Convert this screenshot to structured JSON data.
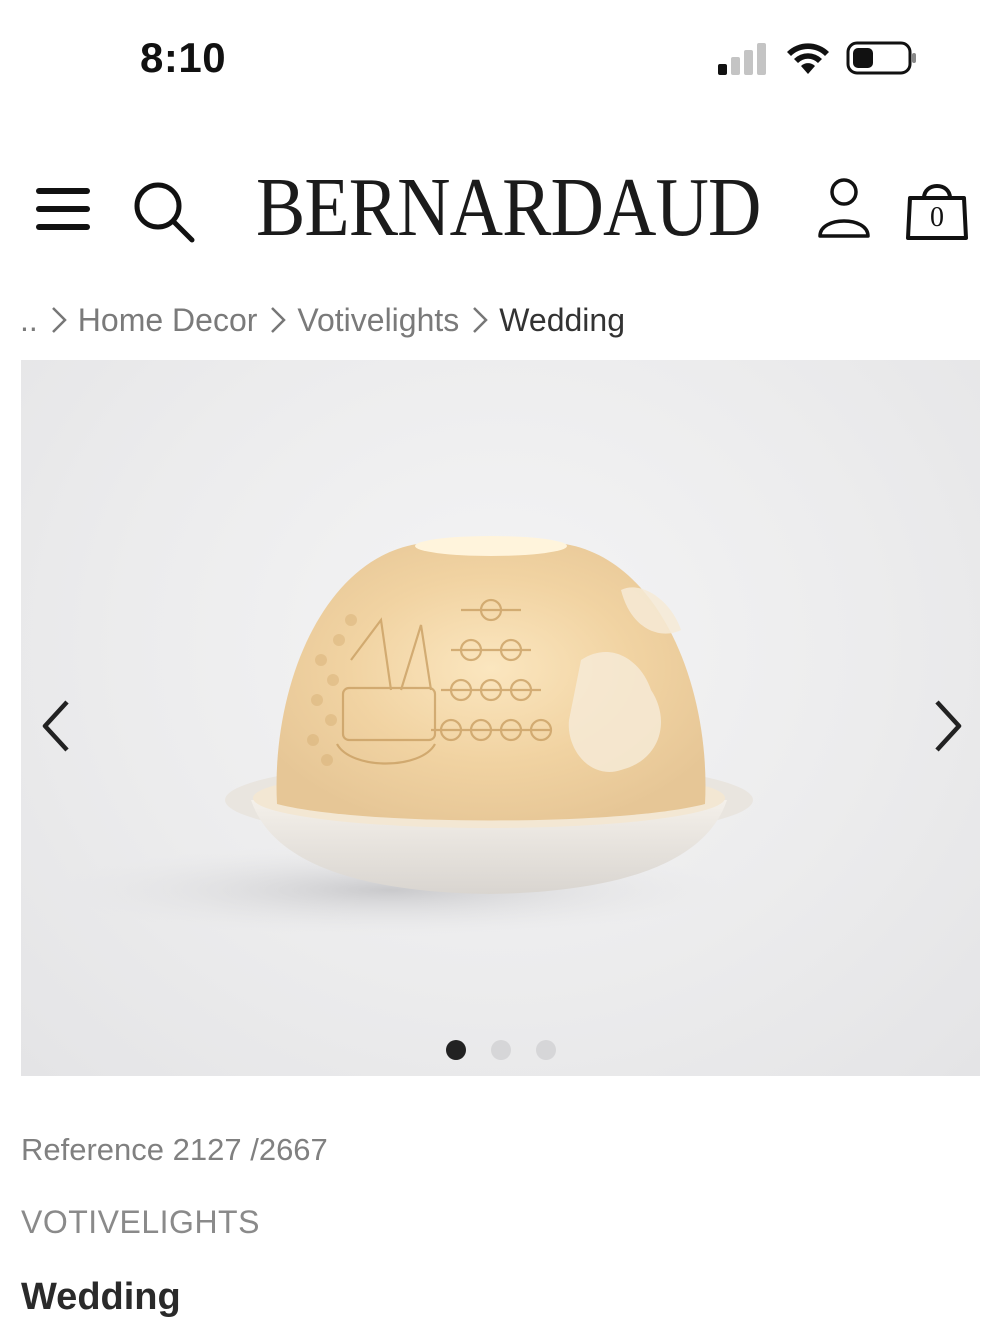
{
  "status_bar": {
    "time": "8:10",
    "icons": [
      "cellular-signal-icon",
      "wifi-icon",
      "battery-icon"
    ]
  },
  "header": {
    "brand": "BERNARDAUD",
    "cart_count": "0",
    "icons": [
      "menu-icon",
      "search-icon",
      "account-icon",
      "shopping-bag-icon"
    ]
  },
  "breadcrumb": {
    "ellipsis": "..",
    "items": [
      "Home Decor",
      "Votivelights"
    ],
    "current": "Wedding"
  },
  "gallery": {
    "image_count": 3,
    "active_index": 0,
    "icons": [
      "chevron-left-icon",
      "chevron-right-icon"
    ]
  },
  "product": {
    "reference": "Reference 2127 /2667",
    "category": "VOTIVELIGHTS",
    "name": "Wedding"
  },
  "colors": {
    "text_dark": "#222222",
    "text_muted": "#7a7a7a",
    "gallery_bg": "#ececed",
    "dot_active": "#222222",
    "dot_inactive": "#d6d6d8"
  }
}
